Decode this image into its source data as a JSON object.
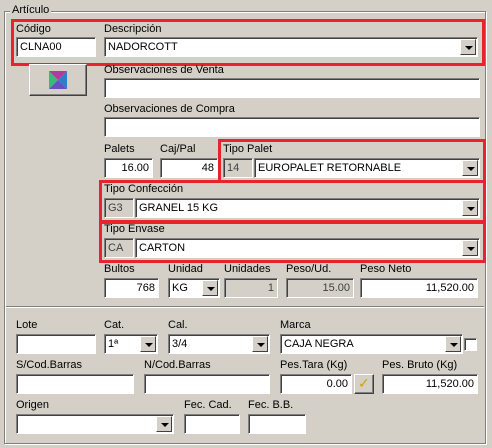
{
  "group_title": "Artículo",
  "codigo": {
    "label": "Código",
    "value": "CLNA00"
  },
  "descripcion": {
    "label": "Descripción",
    "value": "NADORCOTT"
  },
  "obs_venta": {
    "label": "Observaciones de Venta",
    "value": ""
  },
  "obs_compra": {
    "label": "Observaciones de Compra",
    "value": ""
  },
  "palets": {
    "label": "Palets",
    "value": "16.00"
  },
  "caj_pal": {
    "label": "Caj/Pal",
    "value": "48"
  },
  "tipo_palet": {
    "label": "Tipo Palet",
    "code": "14",
    "value": "EUROPALET RETORNABLE"
  },
  "tipo_confeccion": {
    "label": "Tipo Confección",
    "code": "G3",
    "value": "GRANEL 15 KG"
  },
  "tipo_envase": {
    "label": "Tipo Envase",
    "code": "CA",
    "value": "CARTON"
  },
  "bultos": {
    "label": "Bultos",
    "value": "768"
  },
  "unidad": {
    "label": "Unidad",
    "value": "KG"
  },
  "unidades": {
    "label": "Unidades",
    "value": "1"
  },
  "peso_ud": {
    "label": "Peso/Ud.",
    "value": "15.00"
  },
  "peso_neto": {
    "label": "Peso Neto",
    "value": "11,520.00"
  },
  "lote": {
    "label": "Lote",
    "value": ""
  },
  "cat": {
    "label": "Cat.",
    "value": "1ª"
  },
  "cal": {
    "label": "Cal.",
    "value": "3/4"
  },
  "marca": {
    "label": "Marca",
    "value": "CAJA NEGRA"
  },
  "s_cod_barras": {
    "label": "S/Cod.Barras",
    "value": ""
  },
  "n_cod_barras": {
    "label": "N/Cod.Barras",
    "value": ""
  },
  "pes_tara": {
    "label": "Pes.Tara (Kg)",
    "value": "0.00"
  },
  "pes_bruto": {
    "label": "Pes. Bruto (Kg)",
    "value": "11,520.00"
  },
  "origen": {
    "label": "Origen",
    "value": ""
  },
  "fec_cad": {
    "label": "Fec. Cad.",
    "value": ""
  },
  "fec_bb": {
    "label": "Fec. B.B.",
    "value": ""
  },
  "colors": {
    "highlight": "#e8232e",
    "face": "#d4d0c8",
    "icon_green": "#3cb878",
    "icon_purple": "#b23a9e",
    "icon_blue": "#2c7fc8"
  },
  "icons": {
    "article_image_button": "bowtie-image-icon",
    "tara_check": "checkmark-icon"
  }
}
